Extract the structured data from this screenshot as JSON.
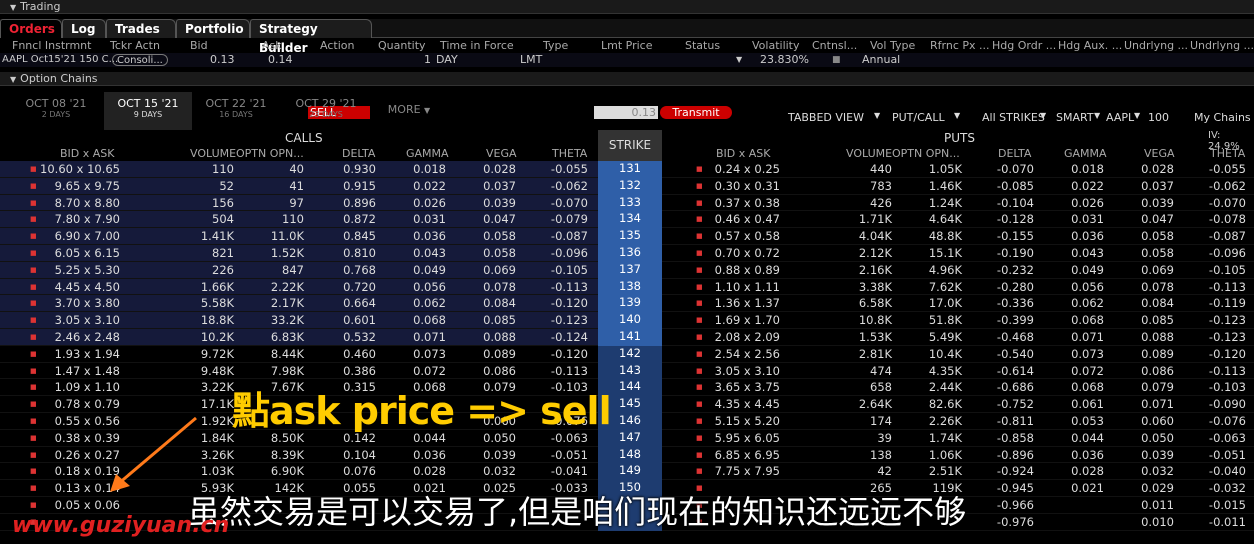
{
  "window_title": "Trading",
  "section_option_chains": "Option Chains",
  "tabs": [
    "Orders",
    "Log",
    "Trades",
    "Portfolio",
    "Strategy Builder"
  ],
  "order_headers": [
    "Fnncl Instrmnt",
    "Tckr Actn",
    "Bid",
    "Ask",
    "Action",
    "Quantity",
    "Time in Force",
    "Type",
    "Lmt Price",
    "Status",
    "Volatility",
    "Cntnsl...",
    "Vol Type",
    "Rfrnc Px ...",
    "Hdg Ordr ...",
    "Hdg Aux. ...",
    "Undrlyng ...",
    "Undrlyng ..."
  ],
  "order": {
    "instrument": "AAPL Oct15'21 150 C...",
    "ticker_action": "Consoli...",
    "bid": "0.13",
    "ask": "0.14",
    "action": "SELL",
    "quantity": "1",
    "tif": "DAY",
    "type": "LMT",
    "lmt_price": "0.13",
    "status": "Transmit",
    "volatility": "23.830%",
    "vol_type": "Annual"
  },
  "expirations": [
    {
      "label": "OCT 08 '21",
      "sub": "2 DAYS"
    },
    {
      "label": "OCT 15 '21",
      "sub": "9 DAYS"
    },
    {
      "label": "OCT 22 '21",
      "sub": "16 DAYS"
    },
    {
      "label": "OCT 29 '21",
      "sub": "23 DAYS"
    }
  ],
  "more_label": "MORE",
  "toolbar": {
    "view": "TABBED VIEW",
    "putcall": "PUT/CALL",
    "strikes": "All STRIKES",
    "exchange": "SMART",
    "symbol": "AAPL",
    "multiplier": "100",
    "my_chains": "My Chains",
    "iv": "IV: 24.9%"
  },
  "calls_label": "CALLS",
  "puts_label": "PUTS",
  "strike_label": "STRIKE",
  "col_headers": {
    "bidask": "BID x ASK",
    "volume": "VOLUME",
    "optn": "OPTN OPN...",
    "delta": "DELTA",
    "gamma": "GAMMA",
    "vega": "VEGA",
    "theta": "THETA"
  },
  "rows": [
    {
      "cb": "10.60 x 10.65",
      "cv": "110",
      "co": "40",
      "cd": "0.930",
      "cg": "0.018",
      "cve": "0.028",
      "ct": "-0.055",
      "k": "131",
      "pb": "0.24 x 0.25",
      "pv": "440",
      "po": "1.05K",
      "pd": "-0.070",
      "pg": "0.018",
      "pve": "0.028",
      "pt": "-0.055"
    },
    {
      "cb": "9.65 x 9.75",
      "cv": "52",
      "co": "41",
      "cd": "0.915",
      "cg": "0.022",
      "cve": "0.037",
      "ct": "-0.062",
      "k": "132",
      "pb": "0.30 x 0.31",
      "pv": "783",
      "po": "1.46K",
      "pd": "-0.085",
      "pg": "0.022",
      "pve": "0.037",
      "pt": "-0.062"
    },
    {
      "cb": "8.70 x 8.80",
      "cv": "156",
      "co": "97",
      "cd": "0.896",
      "cg": "0.026",
      "cve": "0.039",
      "ct": "-0.070",
      "k": "133",
      "pb": "0.37 x 0.38",
      "pv": "426",
      "po": "1.24K",
      "pd": "-0.104",
      "pg": "0.026",
      "pve": "0.039",
      "pt": "-0.070"
    },
    {
      "cb": "7.80 x 7.90",
      "cv": "504",
      "co": "110",
      "cd": "0.872",
      "cg": "0.031",
      "cve": "0.047",
      "ct": "-0.079",
      "k": "134",
      "pb": "0.46 x 0.47",
      "pv": "1.71K",
      "po": "4.64K",
      "pd": "-0.128",
      "pg": "0.031",
      "pve": "0.047",
      "pt": "-0.078"
    },
    {
      "cb": "6.90 x 7.00",
      "cv": "1.41K",
      "co": "11.0K",
      "cd": "0.845",
      "cg": "0.036",
      "cve": "0.058",
      "ct": "-0.087",
      "k": "135",
      "pb": "0.57 x 0.58",
      "pv": "4.04K",
      "po": "48.8K",
      "pd": "-0.155",
      "pg": "0.036",
      "pve": "0.058",
      "pt": "-0.087"
    },
    {
      "cb": "6.05 x 6.15",
      "cv": "821",
      "co": "1.52K",
      "cd": "0.810",
      "cg": "0.043",
      "cve": "0.058",
      "ct": "-0.096",
      "k": "136",
      "pb": "0.70 x 0.72",
      "pv": "2.12K",
      "po": "15.1K",
      "pd": "-0.190",
      "pg": "0.043",
      "pve": "0.058",
      "pt": "-0.096"
    },
    {
      "cb": "5.25 x 5.30",
      "cv": "226",
      "co": "847",
      "cd": "0.768",
      "cg": "0.049",
      "cve": "0.069",
      "ct": "-0.105",
      "k": "137",
      "pb": "0.88 x 0.89",
      "pv": "2.16K",
      "po": "4.96K",
      "pd": "-0.232",
      "pg": "0.049",
      "pve": "0.069",
      "pt": "-0.105"
    },
    {
      "cb": "4.45 x 4.50",
      "cv": "1.66K",
      "co": "2.22K",
      "cd": "0.720",
      "cg": "0.056",
      "cve": "0.078",
      "ct": "-0.113",
      "k": "138",
      "pb": "1.10 x 1.11",
      "pv": "3.38K",
      "po": "7.62K",
      "pd": "-0.280",
      "pg": "0.056",
      "pve": "0.078",
      "pt": "-0.113"
    },
    {
      "cb": "3.70 x 3.80",
      "cv": "5.58K",
      "co": "2.17K",
      "cd": "0.664",
      "cg": "0.062",
      "cve": "0.084",
      "ct": "-0.120",
      "k": "139",
      "pb": "1.36 x 1.37",
      "pv": "6.58K",
      "po": "17.0K",
      "pd": "-0.336",
      "pg": "0.062",
      "pve": "0.084",
      "pt": "-0.119"
    },
    {
      "cb": "3.05 x 3.10",
      "cv": "18.8K",
      "co": "33.2K",
      "cd": "0.601",
      "cg": "0.068",
      "cve": "0.085",
      "ct": "-0.123",
      "k": "140",
      "pb": "1.69 x 1.70",
      "pv": "10.8K",
      "po": "51.8K",
      "pd": "-0.399",
      "pg": "0.068",
      "pve": "0.085",
      "pt": "-0.123"
    },
    {
      "cb": "2.46 x 2.48",
      "cv": "10.2K",
      "co": "6.83K",
      "cd": "0.532",
      "cg": "0.071",
      "cve": "0.088",
      "ct": "-0.124",
      "k": "141",
      "pb": "2.08 x 2.09",
      "pv": "1.53K",
      "po": "5.49K",
      "pd": "-0.468",
      "pg": "0.071",
      "pve": "0.088",
      "pt": "-0.123"
    },
    {
      "cb": "1.93 x 1.94",
      "cv": "9.72K",
      "co": "8.44K",
      "cd": "0.460",
      "cg": "0.073",
      "cve": "0.089",
      "ct": "-0.120",
      "k": "142",
      "pb": "2.54 x 2.56",
      "pv": "2.81K",
      "po": "10.4K",
      "pd": "-0.540",
      "pg": "0.073",
      "pve": "0.089",
      "pt": "-0.120"
    },
    {
      "cb": "1.47 x 1.48",
      "cv": "9.48K",
      "co": "7.98K",
      "cd": "0.386",
      "cg": "0.072",
      "cve": "0.086",
      "ct": "-0.113",
      "k": "143",
      "pb": "3.05 x 3.10",
      "pv": "474",
      "po": "4.35K",
      "pd": "-0.614",
      "pg": "0.072",
      "pve": "0.086",
      "pt": "-0.113"
    },
    {
      "cb": "1.09 x 1.10",
      "cv": "3.22K",
      "co": "7.67K",
      "cd": "0.315",
      "cg": "0.068",
      "cve": "0.079",
      "ct": "-0.103",
      "k": "144",
      "pb": "3.65 x 3.75",
      "pv": "658",
      "po": "2.44K",
      "pd": "-0.686",
      "pg": "0.068",
      "pve": "0.079",
      "pt": "-0.103"
    },
    {
      "cb": "0.78 x 0.79",
      "cv": "17.1K",
      "co": "",
      "cd": "",
      "cg": "",
      "cve": "",
      "ct": "",
      "k": "145",
      "pb": "4.35 x 4.45",
      "pv": "2.64K",
      "po": "82.6K",
      "pd": "-0.752",
      "pg": "0.061",
      "pve": "0.071",
      "pt": "-0.090"
    },
    {
      "cb": "0.55 x 0.56",
      "cv": "1.92K",
      "co": "",
      "cd": "",
      "cg": "",
      "cve": "0.060",
      "ct": "-0.076",
      "k": "146",
      "pb": "5.15 x 5.20",
      "pv": "174",
      "po": "2.26K",
      "pd": "-0.811",
      "pg": "0.053",
      "pve": "0.060",
      "pt": "-0.076"
    },
    {
      "cb": "0.38 x 0.39",
      "cv": "1.84K",
      "co": "8.50K",
      "cd": "0.142",
      "cg": "0.044",
      "cve": "0.050",
      "ct": "-0.063",
      "k": "147",
      "pb": "5.95 x 6.05",
      "pv": "39",
      "po": "1.74K",
      "pd": "-0.858",
      "pg": "0.044",
      "pve": "0.050",
      "pt": "-0.063"
    },
    {
      "cb": "0.26 x 0.27",
      "cv": "3.26K",
      "co": "8.39K",
      "cd": "0.104",
      "cg": "0.036",
      "cve": "0.039",
      "ct": "-0.051",
      "k": "148",
      "pb": "6.85 x 6.95",
      "pv": "138",
      "po": "1.06K",
      "pd": "-0.896",
      "pg": "0.036",
      "pve": "0.039",
      "pt": "-0.051"
    },
    {
      "cb": "0.18 x 0.19",
      "cv": "1.03K",
      "co": "6.90K",
      "cd": "0.076",
      "cg": "0.028",
      "cve": "0.032",
      "ct": "-0.041",
      "k": "149",
      "pb": "7.75 x 7.95",
      "pv": "42",
      "po": "2.51K",
      "pd": "-0.924",
      "pg": "0.028",
      "pve": "0.032",
      "pt": "-0.040"
    },
    {
      "cb": "0.13 x 0.14",
      "cv": "5.93K",
      "co": "142K",
      "cd": "0.055",
      "cg": "0.021",
      "cve": "0.025",
      "ct": "-0.033",
      "k": "150",
      "pb": "",
      "pv": "265",
      "po": "119K",
      "pd": "-0.945",
      "pg": "0.021",
      "pve": "0.029",
      "pt": "-0.032"
    },
    {
      "cb": "0.05 x 0.06",
      "cv": "",
      "co": "",
      "cd": "",
      "cg": "",
      "cve": "",
      "ct": "",
      "k": "",
      "pb": "",
      "pv": "",
      "po": "",
      "pd": "-0.966",
      "pg": "",
      "pve": "0.011",
      "pt": "-0.015"
    },
    {
      "cb": "",
      "cv": "",
      "co": "",
      "cd": "",
      "cg": "",
      "cve": "",
      "ct": "",
      "k": "",
      "pb": "",
      "pv": "",
      "po": "",
      "pd": "-0.976",
      "pg": "",
      "pve": "0.010",
      "pt": "-0.011"
    }
  ],
  "annotation": "點ask price => sell",
  "subtitle": "虽然交易是可以交易了,但是咱们现在的知识还远远不够",
  "watermark": "www.guziyuan.cn",
  "colors": {
    "accent": "#cc0000",
    "call_itm": "#151a3a",
    "strike": "#2b4f8f",
    "annotation": "#ffcc00",
    "arrow": "#ff7a1a"
  }
}
